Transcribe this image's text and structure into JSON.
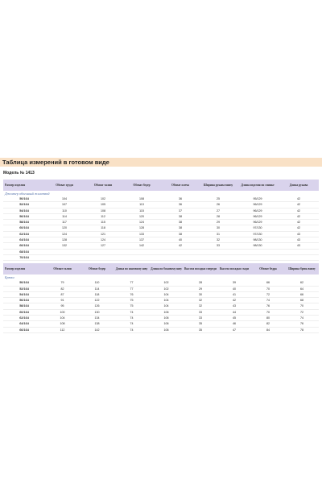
{
  "title": "Таблица измерений в готовом виде",
  "model": "Модель № 1413",
  "table1": {
    "headers": [
      "Размер изделия",
      "Обхват груди",
      "Обхват талии",
      "Обхват бедер",
      "Обхват плеча",
      "Ширина рукава внизу",
      "Длина изделия по спинке",
      "Длина рукава"
    ],
    "section": "Джемпер объемный жилеткой",
    "rows": [
      [
        "50/164",
        "104",
        "102",
        "108",
        "36",
        "25",
        "95/129",
        "42"
      ],
      [
        "52/164",
        "107",
        "105",
        "113",
        "36",
        "26",
        "96/129",
        "42"
      ],
      [
        "54/164",
        "110",
        "108",
        "115",
        "37",
        "27",
        "96/129",
        "42"
      ],
      [
        "56/164",
        "114",
        "112",
        "120",
        "38",
        "28",
        "96/129",
        "42"
      ],
      [
        "58/164",
        "117",
        "115",
        "124",
        "38",
        "29",
        "96/129",
        "42"
      ],
      [
        "60/164",
        "120",
        "118",
        "128",
        "38",
        "30",
        "97/130",
        "42"
      ],
      [
        "62/164",
        "124",
        "121",
        "133",
        "38",
        "31",
        "97/130",
        "43"
      ],
      [
        "64/164",
        "128",
        "124",
        "137",
        "40",
        "32",
        "98/130",
        "43"
      ],
      [
        "66/164",
        "132",
        "127",
        "142",
        "42",
        "33",
        "98/130",
        "43"
      ],
      [
        "68/164",
        "",
        "",
        "",
        "",
        "",
        "",
        ""
      ],
      [
        "70/164",
        "",
        "",
        "",
        "",
        "",
        "",
        ""
      ]
    ]
  },
  "table2": {
    "headers": [
      "Размер изделия",
      "Обхват талии",
      "Обхват бедер",
      "Длина по шаговому шву",
      "Длина по боковому шву",
      "Высота посадки спереди",
      "Высота посадки сзади",
      "Обхват бедра",
      "Ширина брюк внизу"
    ],
    "section": "Брюки",
    "rows": [
      [
        "50/164",
        "79",
        "110",
        "77",
        "102",
        "28",
        "39",
        "66",
        "62"
      ],
      [
        "52/164",
        "82",
        "114",
        "77",
        "102",
        "29",
        "40",
        "70",
        "64"
      ],
      [
        "54/164",
        "87",
        "118",
        "76",
        "104",
        "30",
        "41",
        "72",
        "66"
      ],
      [
        "56/164",
        "91",
        "122",
        "75",
        "104",
        "32",
        "42",
        "74",
        "68"
      ],
      [
        "58/164",
        "95",
        "126",
        "75",
        "104",
        "32",
        "43",
        "76",
        "70"
      ],
      [
        "60/164",
        "100",
        "130",
        "74",
        "106",
        "33",
        "44",
        "70",
        "72"
      ],
      [
        "62/164",
        "104",
        "134",
        "74",
        "106",
        "33",
        "45",
        "80",
        "74"
      ],
      [
        "64/164",
        "108",
        "138",
        "74",
        "106",
        "35",
        "46",
        "82",
        "76"
      ],
      [
        "66/164",
        "112",
        "142",
        "74",
        "106",
        "35",
        "47",
        "84",
        "78"
      ]
    ]
  }
}
